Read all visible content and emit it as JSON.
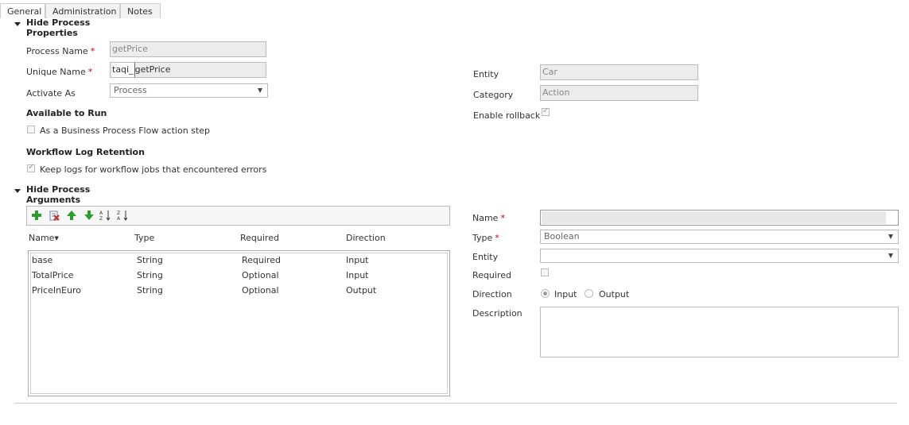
{
  "tabs": [
    {
      "label": "General"
    },
    {
      "label": "Administration"
    },
    {
      "label": "Notes"
    }
  ],
  "properties": {
    "section_title": "Hide Process Properties",
    "process_name": {
      "label": "Process Name",
      "required_mark": "*",
      "value": "getPrice"
    },
    "unique_name": {
      "label": "Unique Name",
      "required_mark": "*",
      "prefix": "taqi_",
      "value": "getPrice"
    },
    "activate_as": {
      "label": "Activate As",
      "value": "Process"
    },
    "available_to_run": {
      "title": "Available to Run",
      "bpf_checkbox_label": "As a Business Process Flow action step",
      "bpf_checked": false
    },
    "log_retention": {
      "title": "Workflow Log Retention",
      "keep_logs_label": "Keep logs for workflow jobs that encountered errors",
      "keep_logs_checked": true
    },
    "entity": {
      "label": "Entity",
      "value": "Car"
    },
    "category": {
      "label": "Category",
      "value": "Action"
    },
    "enable_rollback": {
      "label": "Enable rollback",
      "checked": true
    }
  },
  "arguments": {
    "section_title": "Hide Process Arguments",
    "toolbar_icons": [
      "add-icon",
      "delete-icon",
      "move-up-icon",
      "move-down-icon",
      "sort-ascending-icon",
      "sort-descending-icon"
    ],
    "columns": {
      "name": "Name",
      "type": "Type",
      "required": "Required",
      "direction": "Direction"
    },
    "rows": [
      {
        "name": "base",
        "type": "String",
        "required": "Required",
        "direction": "Input"
      },
      {
        "name": "TotalPrice",
        "type": "String",
        "required": "Optional",
        "direction": "Input"
      },
      {
        "name": "PriceInEuro",
        "type": "String",
        "required": "Optional",
        "direction": "Output"
      }
    ]
  },
  "detail": {
    "name": {
      "label": "Name",
      "required_mark": "*",
      "value": ""
    },
    "type": {
      "label": "Type",
      "required_mark": "*",
      "value": "Boolean"
    },
    "entity": {
      "label": "Entity",
      "value": ""
    },
    "required": {
      "label": "Required",
      "checked": false
    },
    "direction": {
      "label": "Direction",
      "input_label": "Input",
      "output_label": "Output",
      "selected": "Input"
    },
    "description": {
      "label": "Description",
      "value": ""
    }
  },
  "colors": {
    "required_star": "#cc0000",
    "border": "#bbbbbb",
    "readonly_bg": "#ececec",
    "add_green": "#2a9d2a",
    "delete_red": "#cc2222"
  }
}
